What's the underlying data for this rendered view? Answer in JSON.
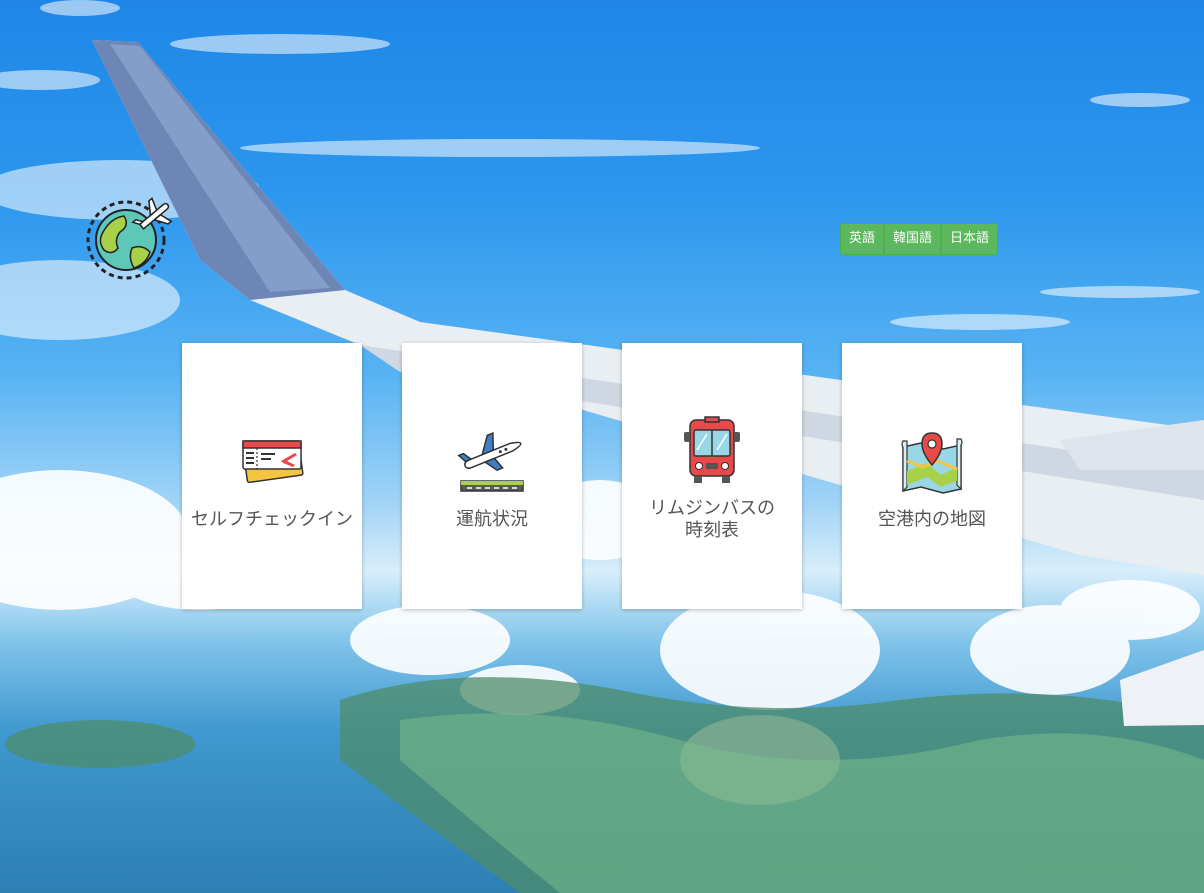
{
  "language_buttons": [
    {
      "label": "英語"
    },
    {
      "label": "韓国語"
    },
    {
      "label": "日本語"
    }
  ],
  "cards": [
    {
      "label": "セルフチェックイン",
      "icon": "ticket-icon"
    },
    {
      "label": "運航状況",
      "icon": "airplane-takeoff-icon"
    },
    {
      "label": "リムジンバスの\n時刻表",
      "icon": "bus-icon"
    },
    {
      "label": "空港内の地図",
      "icon": "map-pin-icon"
    }
  ],
  "colors": {
    "language_button": "#5cb85c",
    "card_background": "#ffffff",
    "card_text": "#555555"
  }
}
